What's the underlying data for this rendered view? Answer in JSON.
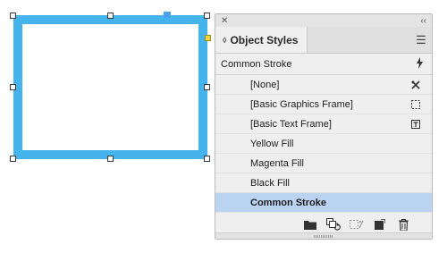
{
  "panel": {
    "title": "Object Styles",
    "close_icon": "close-icon",
    "collapse_icon": "double-chevron-icon",
    "menu_icon": "hamburger-menu-icon",
    "current_style": "Common Stroke",
    "current_style_icon": "lightning-icon",
    "items": [
      {
        "label": "[None]",
        "icon": "no-style-icon",
        "selected": false
      },
      {
        "label": "[Basic Graphics Frame]",
        "icon": "graphics-frame-icon",
        "selected": false
      },
      {
        "label": "[Basic Text Frame]",
        "icon": "text-frame-icon",
        "selected": false
      },
      {
        "label": "Yellow Fill",
        "icon": "",
        "selected": false
      },
      {
        "label": "Magenta Fill",
        "icon": "",
        "selected": false
      },
      {
        "label": "Black Fill",
        "icon": "",
        "selected": false
      },
      {
        "label": "Common Stroke",
        "icon": "",
        "selected": true
      }
    ],
    "toolbar": [
      "folder-icon",
      "load-styles-icon",
      "clear-overrides-icon",
      "new-style-icon",
      "trash-icon"
    ]
  },
  "colors": {
    "frame_stroke": "#45b4ec",
    "selected_row": "#b9d3f1",
    "anchor": "#4aa2ee",
    "port": "#f7d53a"
  }
}
